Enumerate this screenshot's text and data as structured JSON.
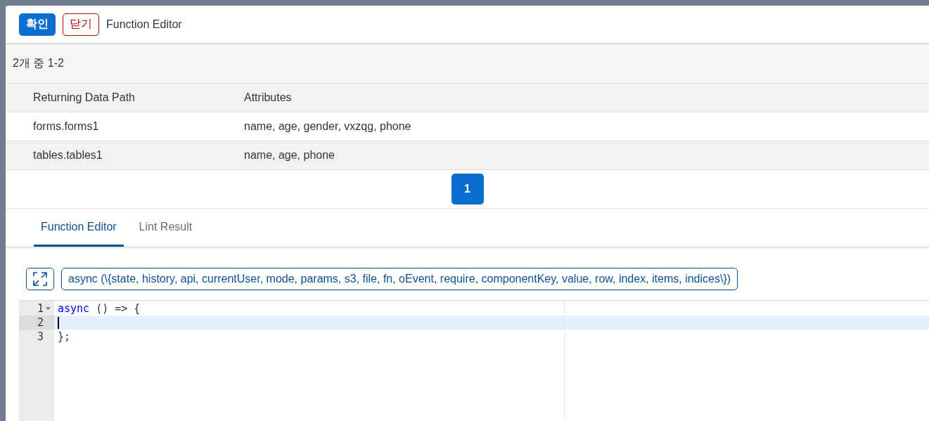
{
  "dialog": {
    "confirm_button": "확인",
    "close_button": "닫기",
    "title": "Function Editor"
  },
  "table": {
    "count": "2개 중 1-2",
    "columns": [
      "Returning Data Path",
      "Attributes"
    ],
    "rows": [
      {
        "cells": [
          "forms.forms1",
          "name, age, gender, vxzqg, phone"
        ]
      },
      {
        "cells": [
          "tables.tables1",
          "name, age, phone"
        ]
      }
    ]
  },
  "pagination": [
    {
      "label": "1",
      "selected": true
    }
  ],
  "tabs": [
    {
      "label": "Function Editor",
      "selected": true
    },
    {
      "label": "Lint Result",
      "selected": false
    }
  ],
  "signature": "async (\\{state, history, api, currentUser, mode, params, s3, file, fn, oEvent, require, componentKey, value, row, index, items, indices\\})",
  "editor": {
    "lines": [
      {
        "number": "1",
        "foldable": true,
        "active": false,
        "tokens": [
          {
            "kind": "keyword",
            "text": "async"
          },
          {
            "kind": "plain",
            "text": " () => {"
          }
        ]
      },
      {
        "number": "2",
        "foldable": false,
        "active": true
      },
      {
        "number": "3",
        "foldable": false,
        "active": false,
        "tokens": [
          {
            "kind": "plain",
            "text": "};"
          }
        ]
      }
    ]
  }
}
